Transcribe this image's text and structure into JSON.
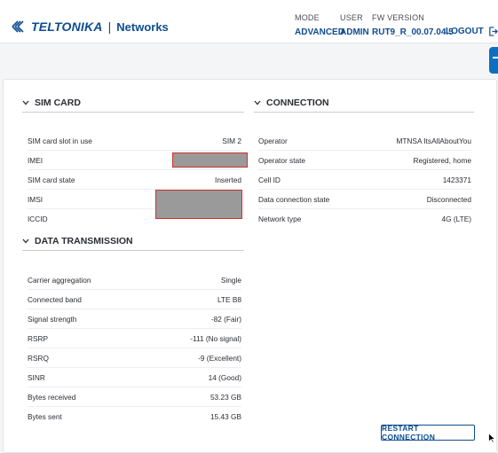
{
  "header": {
    "brand": "TELTONIKA",
    "brand_sub": "Networks",
    "mode_label": "MODE",
    "mode_value": "ADVANCED",
    "user_label": "USER",
    "user_value": "ADMIN",
    "fw_label": "FW VERSION",
    "fw_value": "RUT9_R_00.07.04.5",
    "logout_label": "LOGOUT"
  },
  "sim_card": {
    "title": "SIM CARD",
    "rows": [
      {
        "label": "SIM card slot in use",
        "value": "SIM 2"
      },
      {
        "label": "IMEI",
        "value": ""
      },
      {
        "label": "SIM card state",
        "value": "Inserted"
      },
      {
        "label": "IMSI",
        "value": ""
      },
      {
        "label": "ICCID",
        "value": ""
      }
    ]
  },
  "connection": {
    "title": "CONNECTION",
    "rows": [
      {
        "label": "Operator",
        "value": "MTNSA ItsAllAboutYou"
      },
      {
        "label": "Operator state",
        "value": "Registered, home"
      },
      {
        "label": "Cell ID",
        "value": "1423371"
      },
      {
        "label": "Data connection state",
        "value": "Disconnected"
      },
      {
        "label": "Network type",
        "value": "4G (LTE)"
      }
    ]
  },
  "data_transmission": {
    "title": "DATA TRANSMISSION",
    "rows": [
      {
        "label": "Carrier aggregation",
        "value": "Single"
      },
      {
        "label": "Connected band",
        "value": "LTE B8"
      },
      {
        "label": "Signal strength",
        "value": "-82 (Fair)"
      },
      {
        "label": "RSRP",
        "value": "-111 (No signal)"
      },
      {
        "label": "RSRQ",
        "value": "-9 (Excellent)"
      },
      {
        "label": "SINR",
        "value": "14 (Good)"
      },
      {
        "label": "Bytes received",
        "value": "53.23 GB"
      },
      {
        "label": "Bytes sent",
        "value": "15.43 GB"
      }
    ]
  },
  "actions": {
    "restart_label": "RESTART CONNECTION"
  },
  "colors": {
    "brand": "#0e4d92",
    "accent": "#0e6fc1",
    "redaction": "#9a9a9a",
    "redaction_border": "#d0312d"
  }
}
